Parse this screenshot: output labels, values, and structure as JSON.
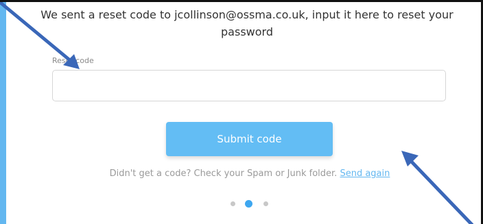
{
  "heading": {
    "text": "We sent a reset code to jcollinson@ossma.co.uk, input it here to reset your password"
  },
  "reset_field": {
    "label": "Reset code",
    "value": "",
    "placeholder": ""
  },
  "submit_button": {
    "label": "Submit code"
  },
  "resend": {
    "prompt": "Didn't get a code? Check your Spam or Junk folder.",
    "link_label": "Send again"
  },
  "pagination": {
    "total": 3,
    "active_index": 2
  },
  "colors": {
    "accent": "#63bdf4",
    "active_dot": "#3ea7f0",
    "annotation_arrow": "#3a67b8"
  },
  "annotations": {
    "arrows": [
      "arrow-to-reset-code-field",
      "arrow-from-bottom-right"
    ]
  }
}
